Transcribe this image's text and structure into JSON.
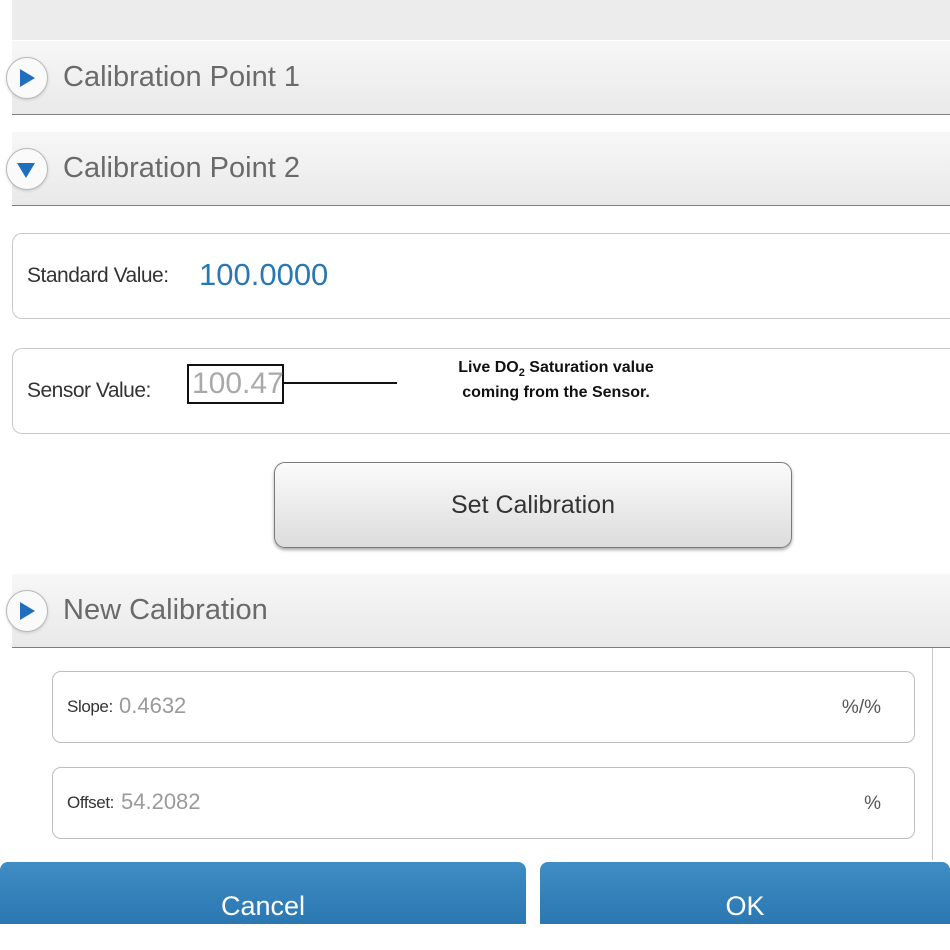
{
  "sections": {
    "point1": {
      "title": "Calibration Point 1",
      "expanded": false
    },
    "point2": {
      "title": "Calibration Point 2",
      "expanded": true
    },
    "new_calibration": {
      "title": "New Calibration",
      "expanded": false
    }
  },
  "standard": {
    "label": "Standard Value:",
    "value": "100.0000"
  },
  "sensor": {
    "label": "Sensor Value:",
    "value": "100.47"
  },
  "callout": {
    "line1_pre": "Live DO",
    "line1_sub": "2",
    "line1_post": " Saturation value",
    "line2": "coming from the Sensor."
  },
  "set_calibration_label": "Set Calibration",
  "slope": {
    "label": "Slope:",
    "value": "0.4632",
    "unit": "%/%"
  },
  "offset": {
    "label": "Offset:",
    "value": "54.2082",
    "unit": "%"
  },
  "buttons": {
    "cancel": "Cancel",
    "ok": "OK"
  },
  "colors": {
    "accent_blue": "#2a78b3",
    "button_blue": "#2b77b2",
    "toggle_arrow": "#1f6fbe"
  },
  "icons": {
    "collapsed": "triangle-right-icon",
    "expanded": "triangle-down-icon"
  }
}
